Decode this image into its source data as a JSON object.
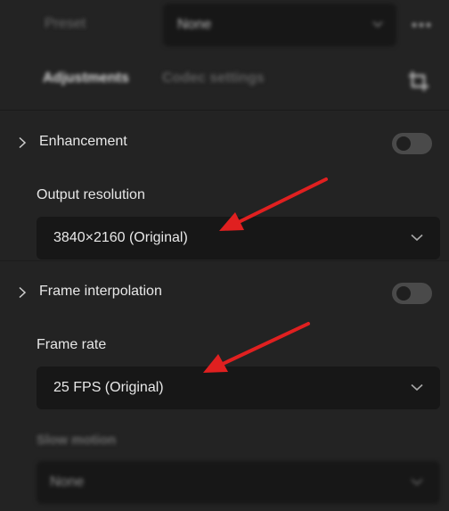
{
  "header": {
    "preset_label": "Preset",
    "preset_value": "None",
    "tabs": [
      {
        "label": "Adjustments",
        "active": true
      },
      {
        "label": "Codec settings",
        "active": false
      }
    ]
  },
  "sections": {
    "enhancement": {
      "title": "Enhancement",
      "enabled": false,
      "output_resolution_label": "Output resolution",
      "output_resolution_value": "3840×2160 (Original)"
    },
    "frame_interpolation": {
      "title": "Frame interpolation",
      "enabled": false,
      "frame_rate_label": "Frame rate",
      "frame_rate_value": "25 FPS (Original)",
      "slow_motion_label": "Slow motion",
      "slow_motion_value": "None"
    }
  },
  "colors": {
    "background": "#232323",
    "dropdown_bg": "#171717",
    "arrow": "#e02020",
    "toggle_off": "#4a4a4a"
  },
  "icons": [
    "chevron-down-icon",
    "more-icon",
    "crop-icon",
    "chevron-right-icon",
    "annotation-arrow-icon"
  ]
}
